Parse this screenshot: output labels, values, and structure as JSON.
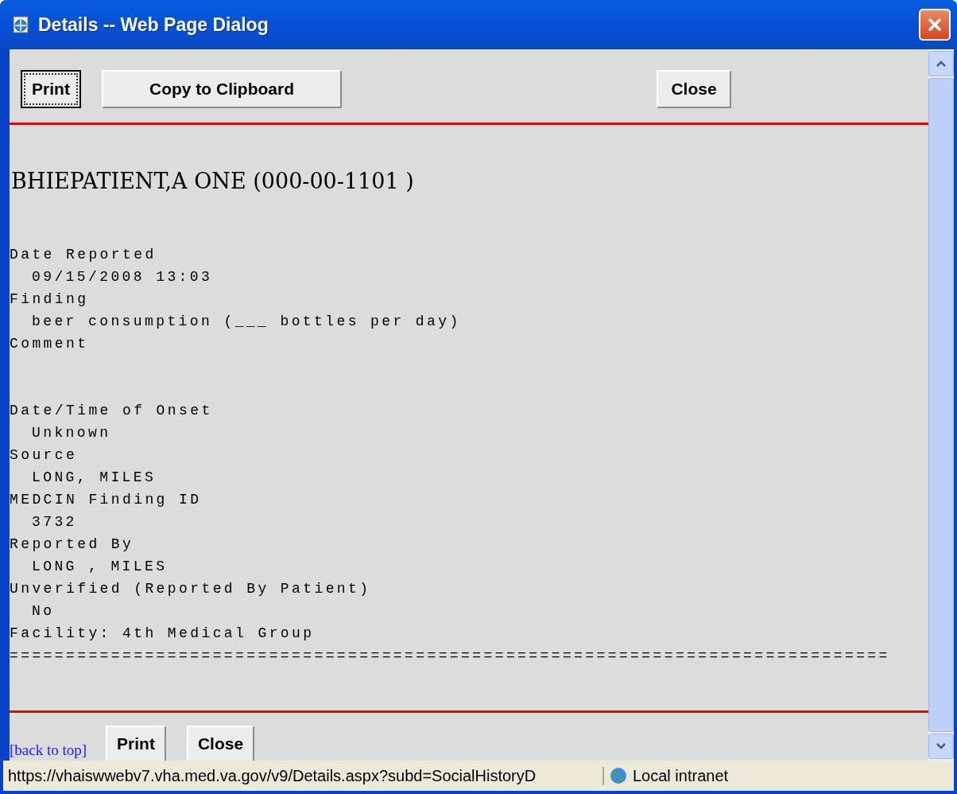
{
  "window": {
    "title": "Details -- Web Page Dialog"
  },
  "top_buttons": [
    {
      "label": "Print",
      "focused": true
    },
    {
      "label": "Copy to Clipboard",
      "focused": false
    },
    {
      "label": "Close",
      "focused": false
    }
  ],
  "patient_heading": "BHIEPATIENT,A ONE (000-00-1101 )",
  "report_lines": [
    {
      "kind": "label",
      "text": "Date Reported"
    },
    {
      "kind": "value",
      "text": "09/15/2008 13:03"
    },
    {
      "kind": "label",
      "text": "Finding"
    },
    {
      "kind": "value",
      "text": "beer consumption (___ bottles per day)"
    },
    {
      "kind": "label",
      "text": "Comment"
    },
    {
      "kind": "spacer"
    },
    {
      "kind": "spacer"
    },
    {
      "kind": "label",
      "text": "Date/Time of Onset"
    },
    {
      "kind": "value",
      "text": "Unknown"
    },
    {
      "kind": "label",
      "text": "Source"
    },
    {
      "kind": "value",
      "text": "LONG, MILES"
    },
    {
      "kind": "label",
      "text": "MEDCIN Finding ID"
    },
    {
      "kind": "value",
      "text": "3732"
    },
    {
      "kind": "label",
      "text": "Reported By"
    },
    {
      "kind": "value",
      "text": "LONG , MILES"
    },
    {
      "kind": "label",
      "text": "Unverified (Reported By Patient)"
    },
    {
      "kind": "value",
      "text": "No"
    },
    {
      "kind": "label",
      "text": "Facility: 4th Medical Group"
    },
    {
      "kind": "label",
      "text": "=============================================================================="
    }
  ],
  "back_to_top_link": "[back to top]",
  "bottom_buttons": [
    {
      "label": "Print",
      "focused": false
    },
    {
      "label": "Close",
      "focused": false
    }
  ],
  "status_bar": {
    "url": "https://vhaiswwebv7.vha.med.va.gov/v9/Details.aspx?subd=SocialHistoryD",
    "zone": "Local intranet"
  }
}
